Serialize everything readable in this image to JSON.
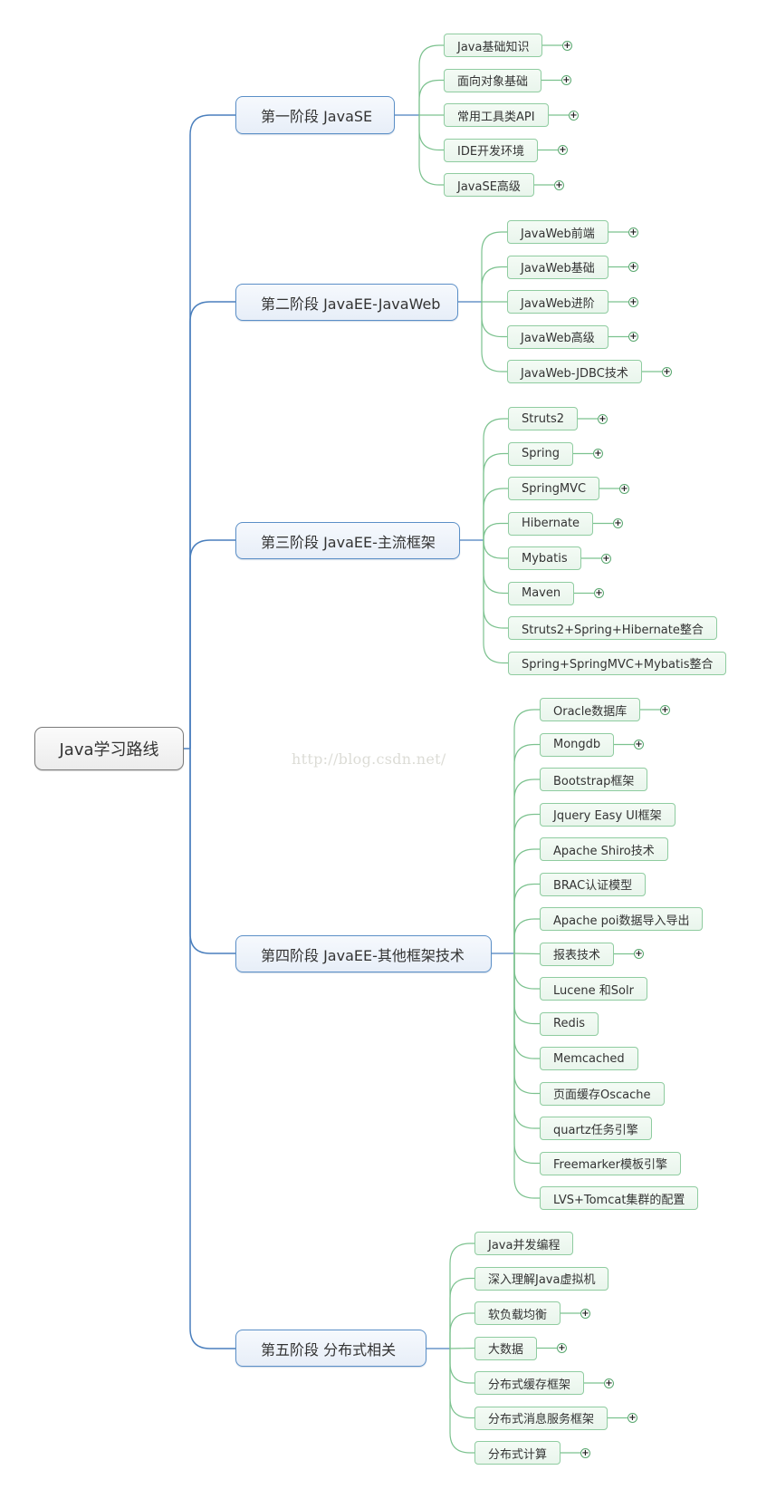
{
  "root": {
    "label": "Java学习路线",
    "icon": "none"
  },
  "watermark": "http://blog.csdn.net/",
  "colors": {
    "root_border": "#7a7a7a",
    "stage_border": "#5b8fc7",
    "stage_connector": "#4a7fbd",
    "leaf_border": "#8fcca0",
    "leaf_connector": "#7cc28f",
    "expand_icon": "#5aa870"
  },
  "stages": [
    {
      "label": "第一阶段 JavaSE",
      "children": [
        {
          "label": "Java基础知识",
          "collapsed": true
        },
        {
          "label": "面向对象基础",
          "collapsed": true
        },
        {
          "label": "常用工具类API",
          "collapsed": true
        },
        {
          "label": "IDE开发环境",
          "collapsed": true
        },
        {
          "label": "JavaSE高级",
          "collapsed": true
        }
      ]
    },
    {
      "label": "第二阶段 JavaEE-JavaWeb",
      "children": [
        {
          "label": "JavaWeb前端",
          "collapsed": true
        },
        {
          "label": "JavaWeb基础",
          "collapsed": true
        },
        {
          "label": "JavaWeb进阶",
          "collapsed": true
        },
        {
          "label": "JavaWeb高级",
          "collapsed": true
        },
        {
          "label": "JavaWeb-JDBC技术",
          "collapsed": true
        }
      ]
    },
    {
      "label": "第三阶段 JavaEE-主流框架",
      "children": [
        {
          "label": "Struts2",
          "collapsed": true
        },
        {
          "label": "Spring",
          "collapsed": true
        },
        {
          "label": "SpringMVC",
          "collapsed": true
        },
        {
          "label": "Hibernate",
          "collapsed": true
        },
        {
          "label": "Mybatis",
          "collapsed": true
        },
        {
          "label": "Maven",
          "collapsed": true
        },
        {
          "label": "Struts2+Spring+Hibernate整合",
          "collapsed": false
        },
        {
          "label": "Spring+SpringMVC+Mybatis整合",
          "collapsed": false
        }
      ]
    },
    {
      "label": "第四阶段 JavaEE-其他框架技术",
      "children": [
        {
          "label": "Oracle数据库",
          "collapsed": true
        },
        {
          "label": "Mongdb",
          "collapsed": true
        },
        {
          "label": "Bootstrap框架",
          "collapsed": false
        },
        {
          "label": "Jquery Easy UI框架",
          "collapsed": false
        },
        {
          "label": "Apache Shiro技术",
          "collapsed": false
        },
        {
          "label": "BRAC认证模型",
          "collapsed": false
        },
        {
          "label": "Apache poi数据导入导出",
          "collapsed": false
        },
        {
          "label": "报表技术",
          "collapsed": true
        },
        {
          "label": "Lucene 和Solr",
          "collapsed": false
        },
        {
          "label": "Redis",
          "collapsed": false
        },
        {
          "label": "Memcached",
          "collapsed": false
        },
        {
          "label": "页面缓存Oscache",
          "collapsed": false
        },
        {
          "label": "quartz任务引擎",
          "collapsed": false
        },
        {
          "label": "Freemarker模板引擎",
          "collapsed": false
        },
        {
          "label": "LVS+Tomcat集群的配置",
          "collapsed": false
        }
      ]
    },
    {
      "label": "第五阶段 分布式相关",
      "children": [
        {
          "label": "Java并发编程",
          "collapsed": false
        },
        {
          "label": "深入理解Java虚拟机",
          "collapsed": false
        },
        {
          "label": "软负载均衡",
          "collapsed": true
        },
        {
          "label": "大数据",
          "collapsed": true
        },
        {
          "label": "分布式缓存框架",
          "collapsed": true
        },
        {
          "label": "分布式消息服务框架",
          "collapsed": true
        },
        {
          "label": "分布式计算",
          "collapsed": true
        }
      ]
    }
  ],
  "expand_symbol": "+"
}
